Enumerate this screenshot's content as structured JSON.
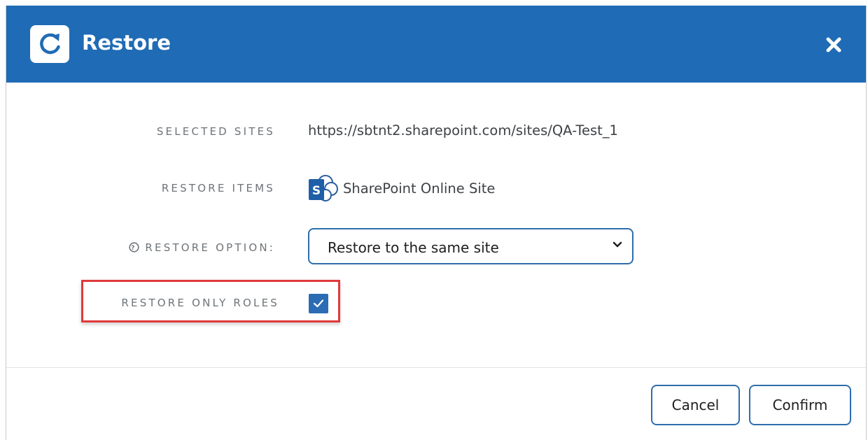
{
  "dialog": {
    "title": "Restore",
    "header_color": "#1f6bb5",
    "header_icon": "restore-refresh-icon",
    "close_icon": "close-icon"
  },
  "form": {
    "selected_sites": {
      "label": "SELECTED SITES",
      "value": "https://sbtnt2.sharepoint.com/sites/QA-Test_1"
    },
    "restore_items": {
      "label": "RESTORE ITEMS",
      "icon": "sharepoint-icon",
      "value": "SharePoint Online Site"
    },
    "restore_option": {
      "label": "RESTORE OPTION:",
      "help_icon": "help-icon",
      "selected": "Restore to the same site"
    },
    "restore_only_roles": {
      "label": "RESTORE ONLY ROLES",
      "checked": true,
      "highlight_color": "#e0393c"
    }
  },
  "footer": {
    "cancel_label": "Cancel",
    "confirm_label": "Confirm"
  },
  "colors": {
    "accent": "#2b6cb5",
    "button_border": "#2e6ead",
    "label_text": "#6e7478"
  }
}
